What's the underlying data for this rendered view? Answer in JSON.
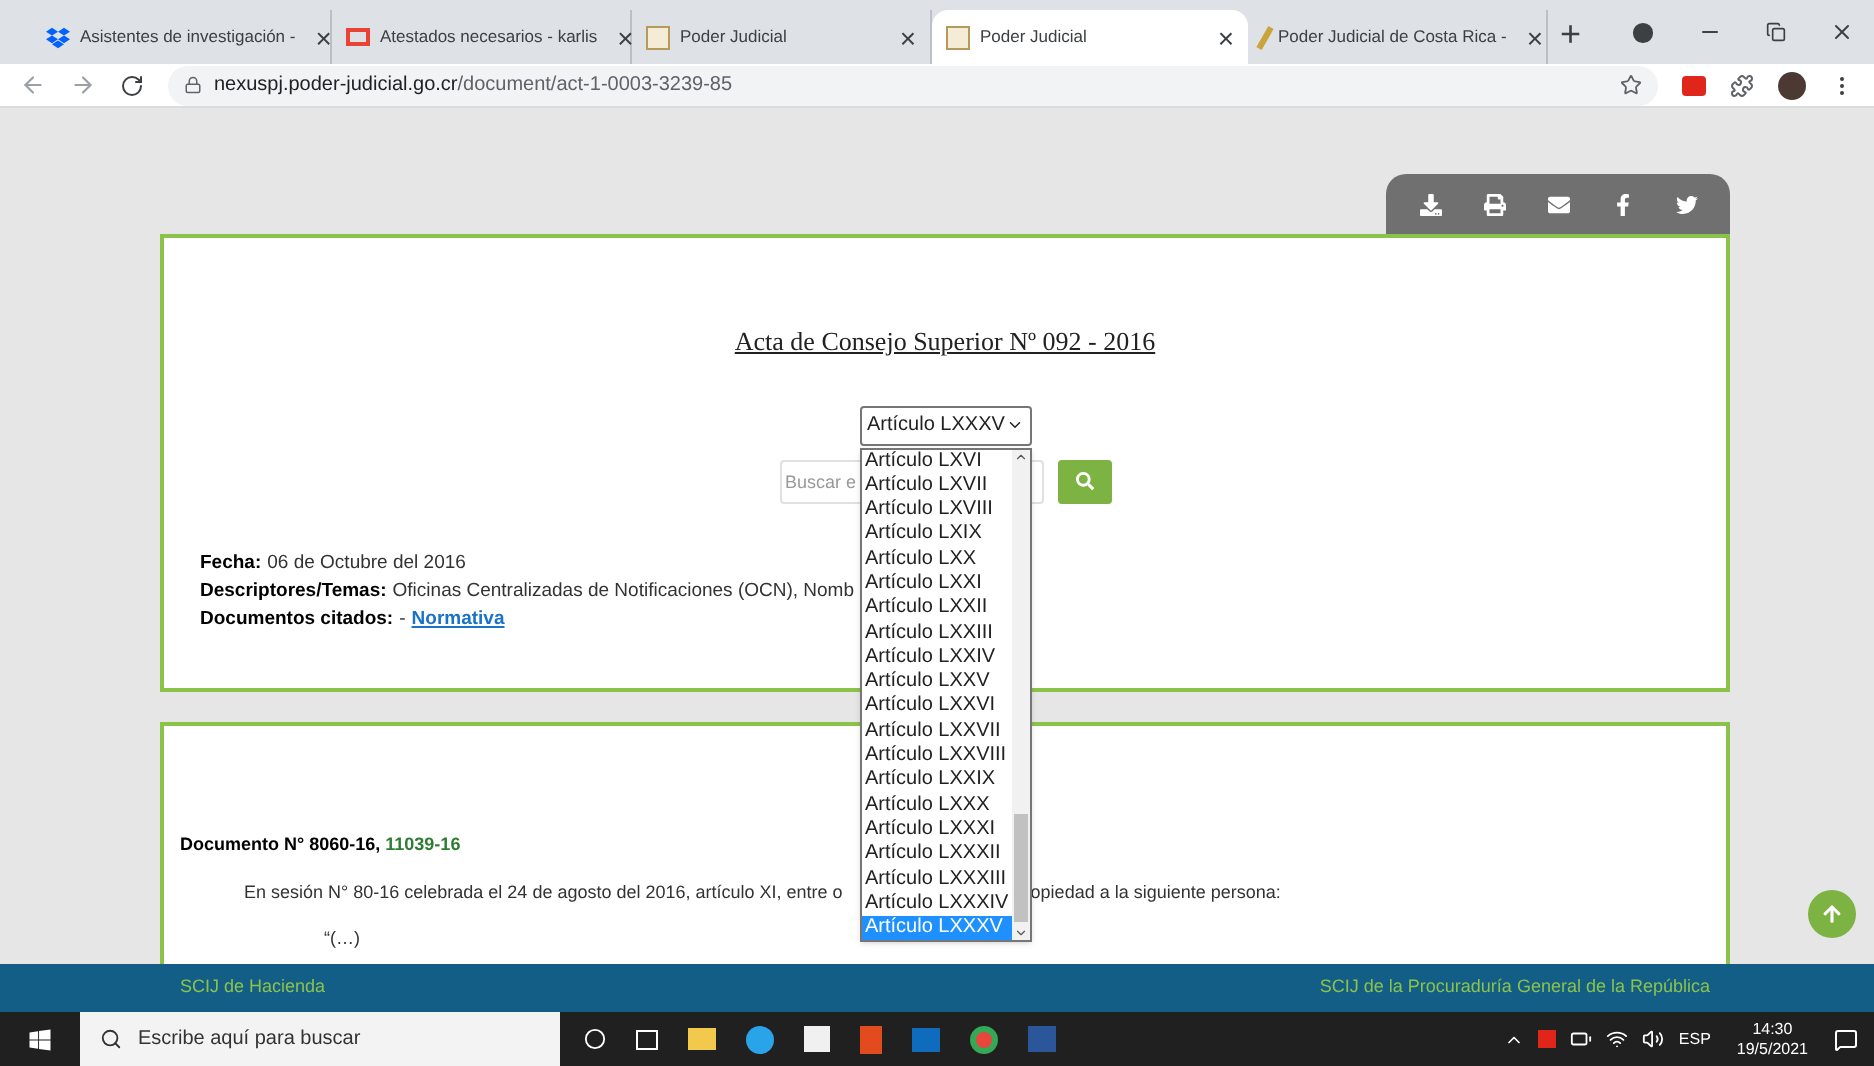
{
  "browser": {
    "tabs": [
      {
        "title": "Asistentes de investigación -",
        "selected": false,
        "kind": "dropbox"
      },
      {
        "title": "Atestados necesarios - karlis",
        "selected": false,
        "kind": "gmail"
      },
      {
        "title": "Poder Judicial",
        "selected": false,
        "kind": "doc"
      },
      {
        "title": "Poder Judicial",
        "selected": true,
        "kind": "doc"
      },
      {
        "title": "Poder Judicial de Costa Rica -",
        "selected": false,
        "kind": "pen"
      }
    ],
    "tab_close": "×",
    "new_tab": "+",
    "url_host": "nexuspj.poder-judicial.go.cr",
    "url_path": "/document/act-1-0003-3239-85"
  },
  "document": {
    "title": "Acta de Consejo Superior Nº 092 - 2016",
    "article_select": {
      "value": "Artículo LXXXV",
      "options": [
        {
          "label": "Artículo LXVI",
          "selected": false
        },
        {
          "label": "Artículo LXVII",
          "selected": false
        },
        {
          "label": "Artículo LXVIII",
          "selected": false
        },
        {
          "label": "Artículo LXIX",
          "selected": false
        },
        {
          "label": "Artículo LXX",
          "selected": false
        },
        {
          "label": "Artículo LXXI",
          "selected": false
        },
        {
          "label": "Artículo LXXII",
          "selected": false
        },
        {
          "label": "Artículo LXXIII",
          "selected": false
        },
        {
          "label": "Artículo LXXIV",
          "selected": false
        },
        {
          "label": "Artículo LXXV",
          "selected": false
        },
        {
          "label": "Artículo LXXVI",
          "selected": false
        },
        {
          "label": "Artículo LXXVII",
          "selected": false
        },
        {
          "label": "Artículo LXXVIII",
          "selected": false
        },
        {
          "label": "Artículo LXXIX",
          "selected": false
        },
        {
          "label": "Artículo LXXX",
          "selected": false
        },
        {
          "label": "Artículo LXXXI",
          "selected": false
        },
        {
          "label": "Artículo LXXXII",
          "selected": false
        },
        {
          "label": "Artículo LXXXIII",
          "selected": false
        },
        {
          "label": "Artículo LXXXIV",
          "selected": false
        },
        {
          "label": "Artículo LXXXV",
          "selected": true
        }
      ]
    },
    "search": {
      "placeholder": "Buscar e"
    },
    "fields": [
      {
        "label": "Fecha:",
        "value": "06 de Octubre del 2016"
      },
      {
        "label": "Descriptores/Temas:",
        "value": "Oficinas Centralizadas de Notificaciones (OCN), Nomb"
      },
      {
        "label": "Documentos citados:",
        "separator": "-",
        "link": "Normativa"
      }
    ],
    "body": {
      "heading": "Documento N° 8060-16,",
      "heading_link": "11039-16",
      "paragraph_start": "En sesión N° 80-16 celebrada el 24 de agosto del 2016, artículo XI, entre o",
      "paragraph_end": "opiedad a la siguiente persona:",
      "quote": "“(…)"
    }
  },
  "footer": {
    "left": "SCIJ de Hacienda",
    "right": "SCIJ de la Procuraduría General de la República"
  },
  "taskbar": {
    "search_placeholder": "Escribe aquí para buscar",
    "language": "ESP",
    "time": "14:30",
    "date": "19/5/2021"
  }
}
